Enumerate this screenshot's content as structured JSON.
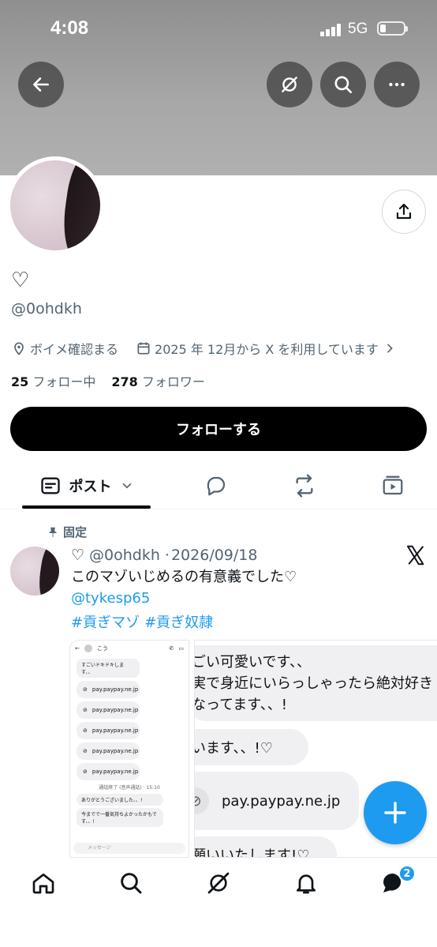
{
  "status_bar": {
    "time": "4:08",
    "network": "5G"
  },
  "header": {
    "back_icon": "arrow-left-icon",
    "grok_icon": "grok-icon",
    "search_icon": "search-icon",
    "more_icon": "more-horizontal-icon"
  },
  "profile": {
    "display_name": "♡",
    "handle": "@0ohdkh",
    "location": "ボイメ確認まる",
    "joined": "2025 年 12月から X を利用しています",
    "following_count": "25",
    "following_label": "フォロー中",
    "followers_count": "278",
    "followers_label": "フォロワー",
    "follow_button": "フォローする"
  },
  "tabs": {
    "posts_label": "ポスト"
  },
  "pinned_tweet": {
    "pinned_label": "固定",
    "author_name": "♡",
    "author_handle": "@0ohdkh",
    "date": "2026/09/18",
    "text": "このマゾいじめるの有意義でした♡",
    "mention": "@tykesp65",
    "hashtags": [
      "#貢ぎマゾ",
      "#貢ぎ奴隷"
    ],
    "media_left": {
      "contact": "こう",
      "first_msg": "すごいドキドキします、、",
      "links": [
        "pay.paypay.ne.jp",
        "pay.paypay.ne.jp",
        "pay.paypay.ne.jp",
        "pay.paypay.ne.jp",
        "pay.paypay.ne.jp"
      ],
      "call_note": "通話終了 (音声通話) · 15:10",
      "msg1": "ありがとうございました、、!",
      "msg2": "今までで一番気持ちよかったかもです、、!",
      "input_placeholder": "メッセージ"
    },
    "media_right": {
      "line1": "ごい可愛いです、、",
      "line2": "実で身近にいらっしゃったら絶対好き",
      "line3": "なってます、、!",
      "bubble2": "います、、!♡",
      "link": "pay.paypay.ne.jp",
      "bubble4": "願いいたします!♡"
    }
  },
  "bottom_nav": {
    "messages_badge": "2"
  },
  "colors": {
    "accent": "#1d9bf0",
    "text": "#0f1419",
    "muted": "#536471"
  }
}
